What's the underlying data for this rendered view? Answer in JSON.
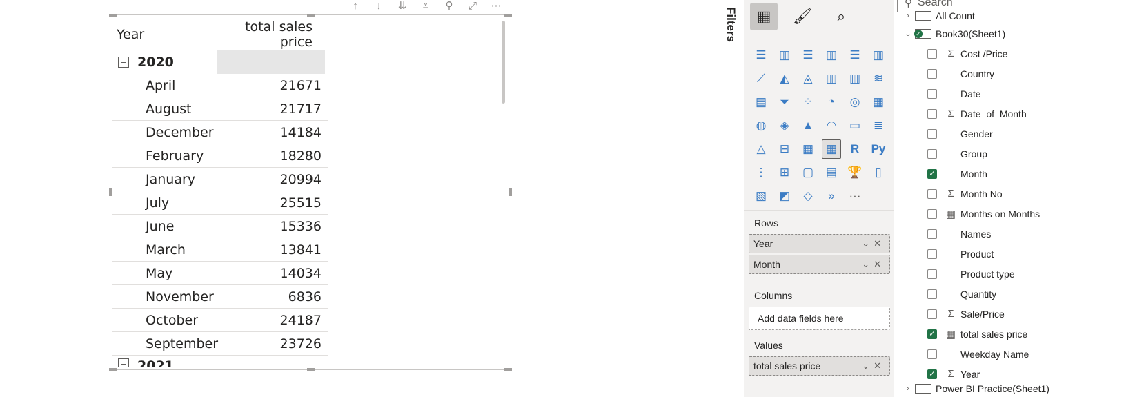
{
  "visual_toolbar": {
    "icons": [
      "arrow-up-icon",
      "arrow-down-icon",
      "double-arrow-down-icon",
      "expand-hierarchy-icon",
      "filter-icon",
      "focus-mode-icon",
      "more-options-icon"
    ],
    "glyphs": [
      "↑",
      "↓",
      "⇊",
      "⩡",
      "⚲",
      "⤢",
      "⋯"
    ]
  },
  "matrix": {
    "headers": [
      "Year",
      "total sales price"
    ],
    "year": "2020",
    "rows": [
      {
        "month": "April",
        "value": "21671"
      },
      {
        "month": "August",
        "value": "21717"
      },
      {
        "month": "December",
        "value": "14184"
      },
      {
        "month": "February",
        "value": "18280"
      },
      {
        "month": "January",
        "value": "20994"
      },
      {
        "month": "July",
        "value": "25515"
      },
      {
        "month": "June",
        "value": "15336"
      },
      {
        "month": "March",
        "value": "13841"
      },
      {
        "month": "May",
        "value": "14034"
      },
      {
        "month": "November",
        "value": "6836"
      },
      {
        "month": "October",
        "value": "24187"
      },
      {
        "month": "September",
        "value": "23726"
      }
    ],
    "next_year_partial": "2021"
  },
  "filters": {
    "label": "Filters"
  },
  "visualizations": {
    "rows_label": "Rows",
    "rows_fields": [
      "Year",
      "Month"
    ],
    "columns_label": "Columns",
    "columns_placeholder": "Add data fields here",
    "values_label": "Values",
    "values_fields": [
      "total sales price"
    ],
    "more": "···"
  },
  "fields": {
    "search_placeholder": "Search",
    "top_partial": "All Count",
    "table_name": "Book30(Sheet1)",
    "items": [
      {
        "name": "Cost /Price",
        "type": "Σ",
        "checked": false
      },
      {
        "name": "Country",
        "type": "",
        "checked": false
      },
      {
        "name": "Date",
        "type": "",
        "checked": false
      },
      {
        "name": "Date_of_Month",
        "type": "Σ",
        "checked": false
      },
      {
        "name": "Gender",
        "type": "",
        "checked": false
      },
      {
        "name": "Group",
        "type": "",
        "checked": false
      },
      {
        "name": "Month",
        "type": "",
        "checked": true
      },
      {
        "name": "Month No",
        "type": "Σ",
        "checked": false
      },
      {
        "name": "Months on Months",
        "type": "▦",
        "checked": false
      },
      {
        "name": "Names",
        "type": "",
        "checked": false
      },
      {
        "name": "Product",
        "type": "",
        "checked": false
      },
      {
        "name": "Product type",
        "type": "",
        "checked": false
      },
      {
        "name": "Quantity",
        "type": "",
        "checked": false
      },
      {
        "name": "Sale/Price",
        "type": "Σ",
        "checked": false
      },
      {
        "name": "total sales price",
        "type": "▦",
        "checked": true
      },
      {
        "name": "Weekday Name",
        "type": "",
        "checked": false
      },
      {
        "name": "Year",
        "type": "Σ",
        "checked": true
      }
    ],
    "bottom_partial": "Power BI Practice(Sheet1)"
  },
  "colors": {
    "accent": "#217346",
    "selection": "#8fb7e5",
    "visual_icon": "#3b7cc4"
  }
}
